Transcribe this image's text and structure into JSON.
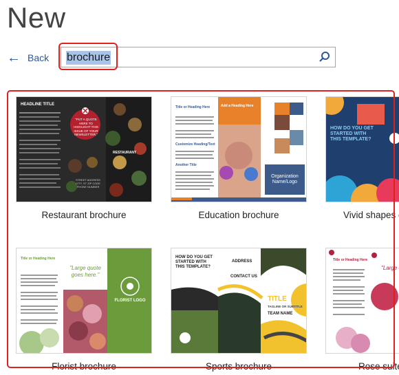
{
  "page": {
    "title": "New"
  },
  "nav": {
    "back_label": "Back"
  },
  "search": {
    "value": "brochure"
  },
  "icons": {
    "back": "back-arrow-icon",
    "search": "search-icon"
  },
  "colors": {
    "accent": "#2b579a",
    "highlight": "#e0201f",
    "selection": "#a8c4e8"
  },
  "templates": [
    {
      "label": "Restaurant brochure",
      "heading": "HEADLINE TITLE",
      "quote": "\"PUT A QUOTE HERE TO HIGHLIGHT THIS ISSUE OF YOUR NEWSLETTER.\"",
      "brand": "RESTAURANT",
      "address": "STREET ADDRESS CITY, ST ZIP CODE PHONE NUMBER"
    },
    {
      "label": "Education brochure",
      "heading": "Title or Heading Here",
      "subheading": "Add a Heading Here",
      "section": "Customize Heading/Text",
      "another": "Another Title",
      "org": "Organization Name/Logo"
    },
    {
      "label": "Vivid shapes ev",
      "heading": "HOW DO YOU GET STARTED WITH THIS TEMPLATE?"
    },
    {
      "label": "Florist brochure",
      "heading": "Title or Heading Here",
      "quote": "\"Large quote goes here.\"",
      "brand": "FLORIST LOGO"
    },
    {
      "label": "Sports brochure",
      "heading": "HOW DO YOU GET STARTED WITH THIS TEMPLATE?",
      "address": "ADDRESS",
      "contact": "CONTACT US",
      "title": "TITLE",
      "tagline": "TAGLINE OR SUBTITLE",
      "team": "TEAM NAME"
    },
    {
      "label": "Rose suite b",
      "heading": "Title or Heading Here",
      "quote": "\"Large quo"
    }
  ]
}
